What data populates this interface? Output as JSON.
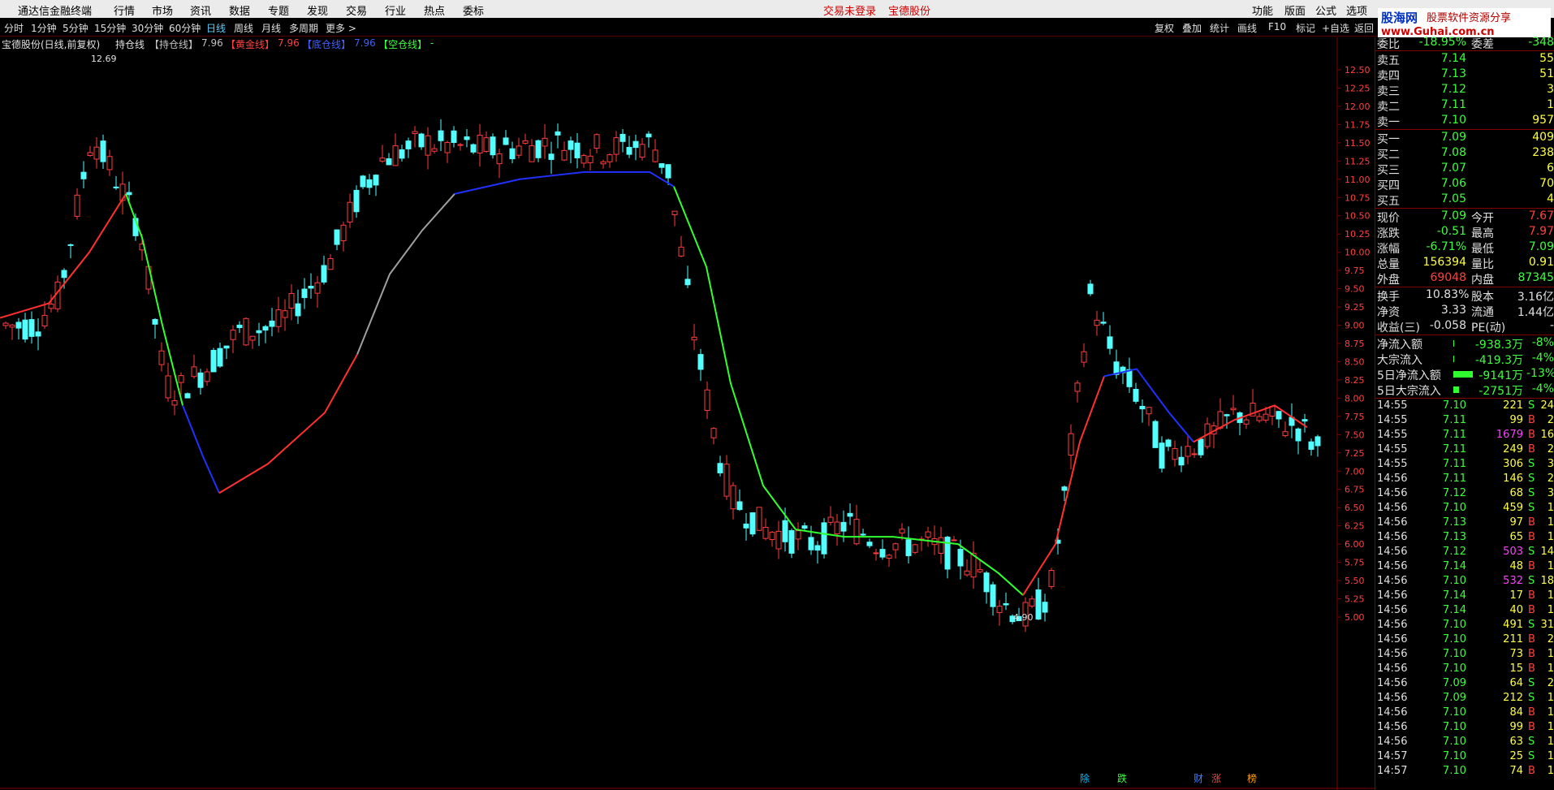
{
  "menu": {
    "app_title": "通达信金融终端",
    "items": [
      "行情",
      "市场",
      "资讯",
      "数据",
      "专题",
      "发现",
      "交易",
      "行业",
      "热点",
      "委标"
    ],
    "login_status": "交易未登录",
    "stock_name": "宝德股份",
    "right_items": [
      "功能",
      "版面",
      "公式",
      "选项"
    ]
  },
  "toolbar": {
    "periods": [
      "分时",
      "1分钟",
      "5分钟",
      "15分钟",
      "30分钟",
      "60分钟",
      "日线",
      "周线",
      "月线",
      "多周期",
      "更多 >"
    ],
    "active": "日线",
    "right_items": [
      "复权",
      "叠加",
      "统计",
      "画线",
      "F10",
      "标记",
      "+自选",
      "返回"
    ]
  },
  "info_line": {
    "title": "宝德股份(日线,前复权)",
    "indicator": "持仓线",
    "items": [
      {
        "label": "【持仓线】",
        "value": "7.96"
      },
      {
        "label": "【黄金线】",
        "value": "7.96"
      },
      {
        "label": "【底仓线】",
        "value": "7.96"
      },
      {
        "label": "【空仓线】",
        "value": "-"
      }
    ]
  },
  "logo": {
    "name": "股海网",
    "slogan": "股票软件资源分享",
    "url": "www.Guhai.com.cn"
  },
  "chart_data": {
    "type": "candlestick",
    "y_ticks": [
      "12.50",
      "12.25",
      "12.00",
      "11.75",
      "11.50",
      "11.25",
      "11.00",
      "10.75",
      "10.50",
      "10.25",
      "10.00",
      "9.75",
      "9.50",
      "9.25",
      "9.00",
      "8.75",
      "8.50",
      "8.25",
      "8.00",
      "7.75",
      "7.50",
      "7.25",
      "7.00",
      "6.75",
      "6.50",
      "6.25",
      "6.00",
      "5.75",
      "5.50",
      "5.25",
      "5.00"
    ],
    "high_label": "12.69",
    "low_label": "4.90",
    "markers": [
      "除",
      "跌",
      "财",
      "涨",
      "榜"
    ]
  },
  "quote": {
    "weibi": {
      "label": "委比",
      "value": "-18.95%",
      "label2": "委差",
      "value2": "-348"
    },
    "asks": [
      {
        "label": "卖五",
        "price": "7.14",
        "vol": "55"
      },
      {
        "label": "卖四",
        "price": "7.13",
        "vol": "51"
      },
      {
        "label": "卖三",
        "price": "7.12",
        "vol": "3"
      },
      {
        "label": "卖二",
        "price": "7.11",
        "vol": "1"
      },
      {
        "label": "卖一",
        "price": "7.10",
        "vol": "957"
      }
    ],
    "bids": [
      {
        "label": "买一",
        "price": "7.09",
        "vol": "409"
      },
      {
        "label": "买二",
        "price": "7.08",
        "vol": "238"
      },
      {
        "label": "买三",
        "price": "7.07",
        "vol": "6"
      },
      {
        "label": "买四",
        "price": "7.06",
        "vol": "70"
      },
      {
        "label": "买五",
        "price": "7.05",
        "vol": "4"
      }
    ],
    "stats": [
      {
        "l1": "现价",
        "v1": "7.09",
        "l2": "今开",
        "v2": "7.67"
      },
      {
        "l1": "涨跌",
        "v1": "-0.51",
        "l2": "最高",
        "v2": "7.97"
      },
      {
        "l1": "涨幅",
        "v1": "-6.71%",
        "l2": "最低",
        "v2": "7.09"
      },
      {
        "l1": "总量",
        "v1": "156394",
        "l2": "量比",
        "v2": "0.91"
      },
      {
        "l1": "外盘",
        "v1": "69048",
        "l2": "内盘",
        "v2": "87345"
      }
    ],
    "fund": [
      {
        "l1": "换手",
        "v1": "10.83%",
        "l2": "股本",
        "v2": "3.16亿"
      },
      {
        "l1": "净资",
        "v1": "3.33",
        "l2": "流通",
        "v2": "1.44亿"
      },
      {
        "l1": "收益(三)",
        "v1": "-0.058",
        "l2": "PE(动)",
        "v2": "-"
      }
    ],
    "flows": [
      {
        "label": "净流入额",
        "value": "-938.3万",
        "pct": "-8%",
        "bar": 0.05
      },
      {
        "label": "大宗流入",
        "value": "-419.3万",
        "pct": "-4%",
        "bar": 0.05
      },
      {
        "label": "5日净流入额",
        "value": "-9141万",
        "pct": "-13%",
        "bar": 0.85
      },
      {
        "label": "5日大宗流入",
        "value": "-2751万",
        "pct": "-4%",
        "bar": 0.25
      }
    ]
  },
  "ticks": [
    [
      "14:55",
      "7.10",
      "221",
      "S",
      "24"
    ],
    [
      "14:55",
      "7.11",
      "99",
      "B",
      "2"
    ],
    [
      "14:55",
      "7.11",
      "1679",
      "B",
      "16"
    ],
    [
      "14:55",
      "7.11",
      "249",
      "B",
      "2"
    ],
    [
      "14:55",
      "7.11",
      "306",
      "S",
      "3"
    ],
    [
      "14:56",
      "7.11",
      "146",
      "S",
      "2"
    ],
    [
      "14:56",
      "7.12",
      "68",
      "S",
      "3"
    ],
    [
      "14:56",
      "7.10",
      "459",
      "S",
      "1"
    ],
    [
      "14:56",
      "7.13",
      "97",
      "B",
      "1"
    ],
    [
      "14:56",
      "7.13",
      "65",
      "B",
      "1"
    ],
    [
      "14:56",
      "7.12",
      "503",
      "S",
      "14"
    ],
    [
      "14:56",
      "7.14",
      "48",
      "B",
      "1"
    ],
    [
      "14:56",
      "7.10",
      "532",
      "S",
      "18"
    ],
    [
      "14:56",
      "7.14",
      "17",
      "B",
      "1"
    ],
    [
      "14:56",
      "7.14",
      "40",
      "B",
      "1"
    ],
    [
      "14:56",
      "7.10",
      "491",
      "S",
      "31"
    ],
    [
      "14:56",
      "7.10",
      "211",
      "B",
      "2"
    ],
    [
      "14:56",
      "7.10",
      "73",
      "B",
      "1"
    ],
    [
      "14:56",
      "7.10",
      "15",
      "B",
      "1"
    ],
    [
      "14:56",
      "7.09",
      "64",
      "S",
      "2"
    ],
    [
      "14:56",
      "7.09",
      "212",
      "S",
      "1"
    ],
    [
      "14:56",
      "7.10",
      "84",
      "B",
      "1"
    ],
    [
      "14:56",
      "7.10",
      "99",
      "B",
      "1"
    ],
    [
      "14:56",
      "7.10",
      "63",
      "S",
      "1"
    ],
    [
      "14:57",
      "7.10",
      "25",
      "S",
      "1"
    ],
    [
      "14:57",
      "7.10",
      "74",
      "B",
      "1"
    ]
  ]
}
